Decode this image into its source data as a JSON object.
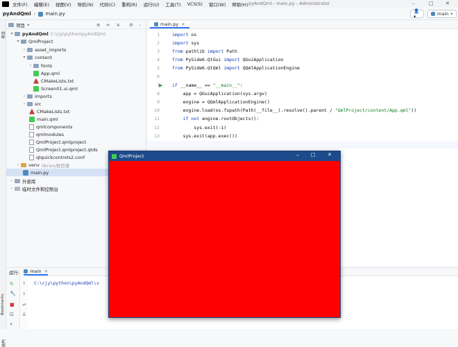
{
  "menubar": {
    "items": [
      "文件(F)",
      "编辑(E)",
      "视图(V)",
      "导航(N)",
      "代码(C)",
      "重构(R)",
      "运行(U)",
      "工具(T)",
      "VCS(S)",
      "窗口(W)",
      "帮助(H)"
    ],
    "window_title": "pyAndQml - main.py - Administrator"
  },
  "navbar": {
    "project": "pyAndQml",
    "file": "main.py",
    "run_config": "main"
  },
  "leftstrip": {
    "project_label": "项目",
    "bookmarks_label": "Bookmarks",
    "structure_label": "结构"
  },
  "project_panel": {
    "title": "项目",
    "rows": [
      {
        "label": "pyAndQml",
        "extra": "C:\\cjy\\python\\pyAndQml"
      },
      {
        "label": "QmlProject",
        "extra": ""
      },
      {
        "label": "asset_imports",
        "extra": ""
      },
      {
        "label": "content",
        "extra": ""
      },
      {
        "label": "fonts",
        "extra": ""
      },
      {
        "label": "App.qml",
        "extra": ""
      },
      {
        "label": "CMakeLists.txt",
        "extra": ""
      },
      {
        "label": "Screen01.ui.qml",
        "extra": ""
      },
      {
        "label": "imports",
        "extra": ""
      },
      {
        "label": "src",
        "extra": ""
      },
      {
        "label": "CMakeLists.txt",
        "extra": ""
      },
      {
        "label": "main.qml",
        "extra": ""
      },
      {
        "label": "qmlcomponents",
        "extra": ""
      },
      {
        "label": "qmlmodules",
        "extra": ""
      },
      {
        "label": "QmlProject.qmlproject",
        "extra": ""
      },
      {
        "label": "QmlProject.qmlproject.qtds",
        "extra": ""
      },
      {
        "label": "qtquickcontrols2.conf",
        "extra": ""
      },
      {
        "label": "venv",
        "extra": "library根目录"
      },
      {
        "label": "main.py",
        "extra": ""
      },
      {
        "label": "外部库",
        "extra": ""
      },
      {
        "label": "临时文件和控制台",
        "extra": ""
      }
    ]
  },
  "editor": {
    "tab": "main.py",
    "line_numbers": [
      "1",
      "2",
      "3",
      "4",
      "5",
      "6",
      "7",
      "8",
      "9",
      "10",
      "11",
      "12",
      "13",
      "14"
    ],
    "lines": [
      "import os",
      "import sys",
      "from pathlib import Path",
      "from PySide6.QtGui import QGuiApplication",
      "from PySide6.QtQml import QQmlApplicationEngine",
      "",
      "if __name__ == \"__main__\":",
      "    app = QGuiApplication(sys.argv)",
      "    engine = QQmlApplicationEngine()",
      "    engine.load(os.fspath(Path(__file__).resolve().parent / \"QmlProject/content/App.qml\"))",
      "    if not engine.rootObjects():",
      "        sys.exit(-1)",
      "    sys.exit(app.exec())",
      ""
    ]
  },
  "run_panel": {
    "label": "运行:",
    "tab": "main",
    "output": "C:\\cjy\\python\\pyAndQml\\v"
  },
  "qml_window": {
    "title": "QmlProject",
    "background": "#ff0000"
  }
}
